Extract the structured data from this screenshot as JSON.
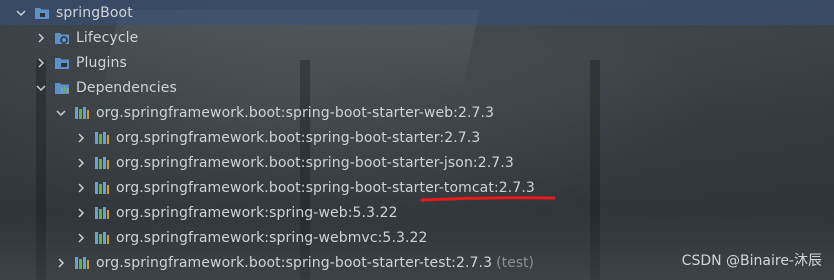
{
  "project_tree": {
    "root": {
      "label": "springBoot"
    },
    "lifecycle": {
      "label": "Lifecycle"
    },
    "plugins": {
      "label": "Plugins"
    },
    "dependencies": {
      "label": "Dependencies",
      "items": [
        {
          "label": "org.springframework.boot:spring-boot-starter-web:2.7.3"
        },
        {
          "label": "org.springframework.boot:spring-boot-starter:2.7.3"
        },
        {
          "label": "org.springframework.boot:spring-boot-starter-json:2.7.3"
        },
        {
          "label": "org.springframework.boot:spring-boot-starter-tomcat:2.7.3"
        },
        {
          "label": "org.springframework:spring-web:5.3.22"
        },
        {
          "label": "org.springframework:spring-webmvc:5.3.22"
        },
        {
          "label": "org.springframework.boot:spring-boot-starter-test:2.7.3",
          "suffix": "(test)"
        }
      ]
    }
  },
  "watermark": "CSDN @Binaire-沐辰",
  "colors": {
    "text": "#cfd3d8",
    "suffix": "#8a8f94",
    "selection": "#37507d",
    "underline": "#e8191a",
    "library_bars": [
      "#6aa0d8",
      "#62b543",
      "#c9a227"
    ]
  },
  "icons": {
    "root": "module-folder-icon",
    "lifecycle": "lifecycle-folder-icon",
    "plugins": "plugins-folder-icon",
    "dependencies": "dependencies-folder-icon",
    "library": "library-bars-icon"
  }
}
